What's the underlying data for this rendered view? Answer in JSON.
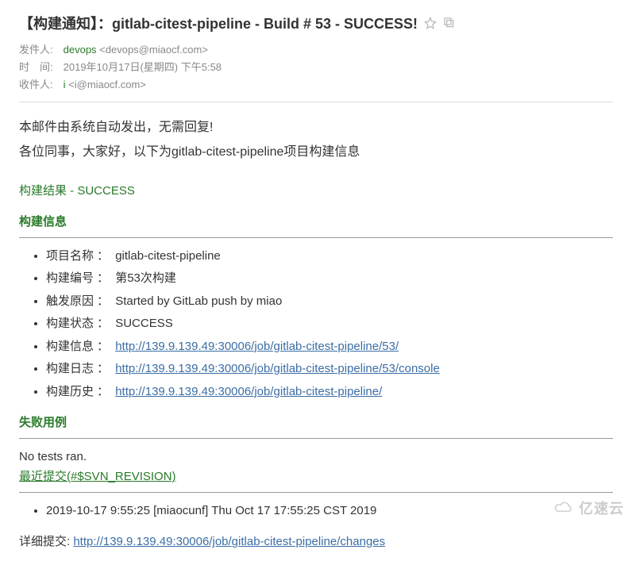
{
  "header": {
    "subject": "【构建通知】：gitlab-citest-pipeline - Build # 53 - SUCCESS!",
    "from_label": "发件人:",
    "from_name": "devops",
    "from_email": "<devops@miaocf.com>",
    "time_label": "时　间:",
    "time_value": "2019年10月17日(星期四) 下午5:58",
    "to_label": "收件人:",
    "to_name": "i",
    "to_email": "<i@miaocf.com>"
  },
  "body": {
    "intro1": "本邮件由系统自动发出，无需回复!",
    "intro2": "各位同事，大家好，以下为gitlab-citest-pipeline项目构建信息",
    "result_label": "构建结果 - SUCCESS",
    "build_info_heading": "构建信息",
    "build_items": [
      {
        "label": "项目名称",
        "value": "gitlab-citest-pipeline",
        "link": false
      },
      {
        "label": "构建编号",
        "value": "第53次构建",
        "link": false
      },
      {
        "label": "触发原因",
        "value": "Started by GitLab push by miao",
        "link": false
      },
      {
        "label": "构建状态",
        "value": "SUCCESS",
        "link": false
      },
      {
        "label": "构建信息",
        "value": "http://139.9.139.49:30006/job/gitlab-citest-pipeline/53/",
        "link": true
      },
      {
        "label": "构建日志",
        "value": "http://139.9.139.49:30006/job/gitlab-citest-pipeline/53/console",
        "link": true
      },
      {
        "label": "构建历史",
        "value": "http://139.9.139.49:30006/job/gitlab-citest-pipeline/",
        "link": true
      }
    ],
    "failed_cases_heading": "失败用例",
    "no_tests_text": "No tests ran.",
    "recent_commit_label": "最近提交(#$SVN_REVISION)",
    "commits": [
      "2019-10-17 9:55:25 [miaocunf] Thu Oct 17 17:55:25 CST 2019"
    ],
    "detail_commit_label": "详细提交:",
    "detail_commit_link": "http://139.9.139.49:30006/job/gitlab-citest-pipeline/changes"
  },
  "watermark": "亿速云"
}
